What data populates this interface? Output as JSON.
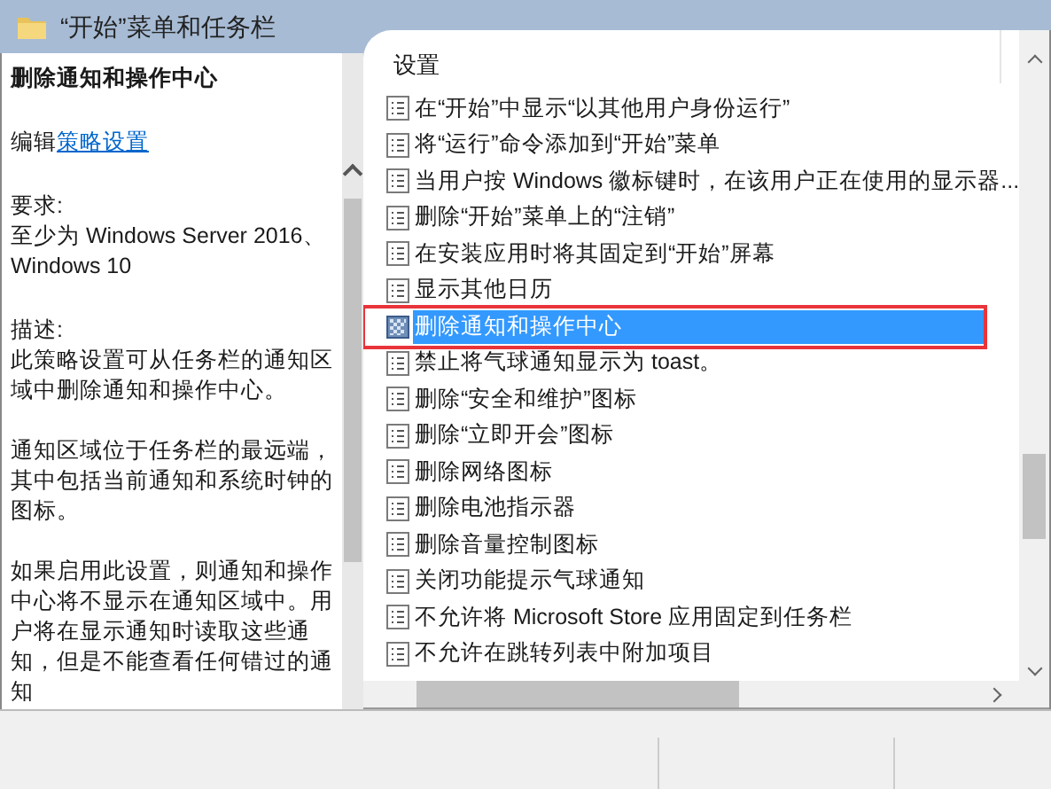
{
  "window": {
    "title": "“开始”菜单和任务栏"
  },
  "description": {
    "title": "删除通知和操作中心",
    "edit_prefix": "编辑",
    "edit_link": "策略设置",
    "requirements_label": "要求:",
    "requirements": "至少为 Windows Server 2016、Windows 10",
    "description_label": "描述:",
    "paragraphs": [
      "此策略设置可从任务栏的通知区域中删除通知和操作中心。",
      "通知区域位于任务栏的最远端，其中包括当前通知和系统时钟的图标。",
      "如果启用此设置，则通知和操作中心将不显示在通知区域中。用户将在显示通知时读取这些通知，但是不能查看任何错过的通知"
    ]
  },
  "settings": {
    "header": "设置",
    "items": [
      {
        "label": "在“开始”中显示“以其他用户身份运行”",
        "selected": false,
        "annotated": false
      },
      {
        "label": "将“运行”命令添加到“开始”菜单",
        "selected": false,
        "annotated": false
      },
      {
        "label": "当用户按 Windows 徽标键时，在该用户正在使用的显示器...",
        "selected": false,
        "annotated": false
      },
      {
        "label": "删除“开始”菜单上的“注销”",
        "selected": false,
        "annotated": false
      },
      {
        "label": "在安装应用时将其固定到“开始”屏幕",
        "selected": false,
        "annotated": false
      },
      {
        "label": "显示其他日历",
        "selected": false,
        "annotated": false
      },
      {
        "label": "删除通知和操作中心",
        "selected": true,
        "annotated": true
      },
      {
        "label": "禁止将气球通知显示为 toast。",
        "selected": false,
        "annotated": false
      },
      {
        "label": "删除“安全和维护”图标",
        "selected": false,
        "annotated": false
      },
      {
        "label": "删除“立即开会”图标",
        "selected": false,
        "annotated": false
      },
      {
        "label": "删除网络图标",
        "selected": false,
        "annotated": false
      },
      {
        "label": "删除电池指示器",
        "selected": false,
        "annotated": false
      },
      {
        "label": "删除音量控制图标",
        "selected": false,
        "annotated": false
      },
      {
        "label": "关闭功能提示气球通知",
        "selected": false,
        "annotated": false
      },
      {
        "label": "不允许将 Microsoft Store 应用固定到任务栏",
        "selected": false,
        "annotated": false
      },
      {
        "label": "不允许在跳转列表中附加项目",
        "selected": false,
        "annotated": false
      }
    ]
  }
}
